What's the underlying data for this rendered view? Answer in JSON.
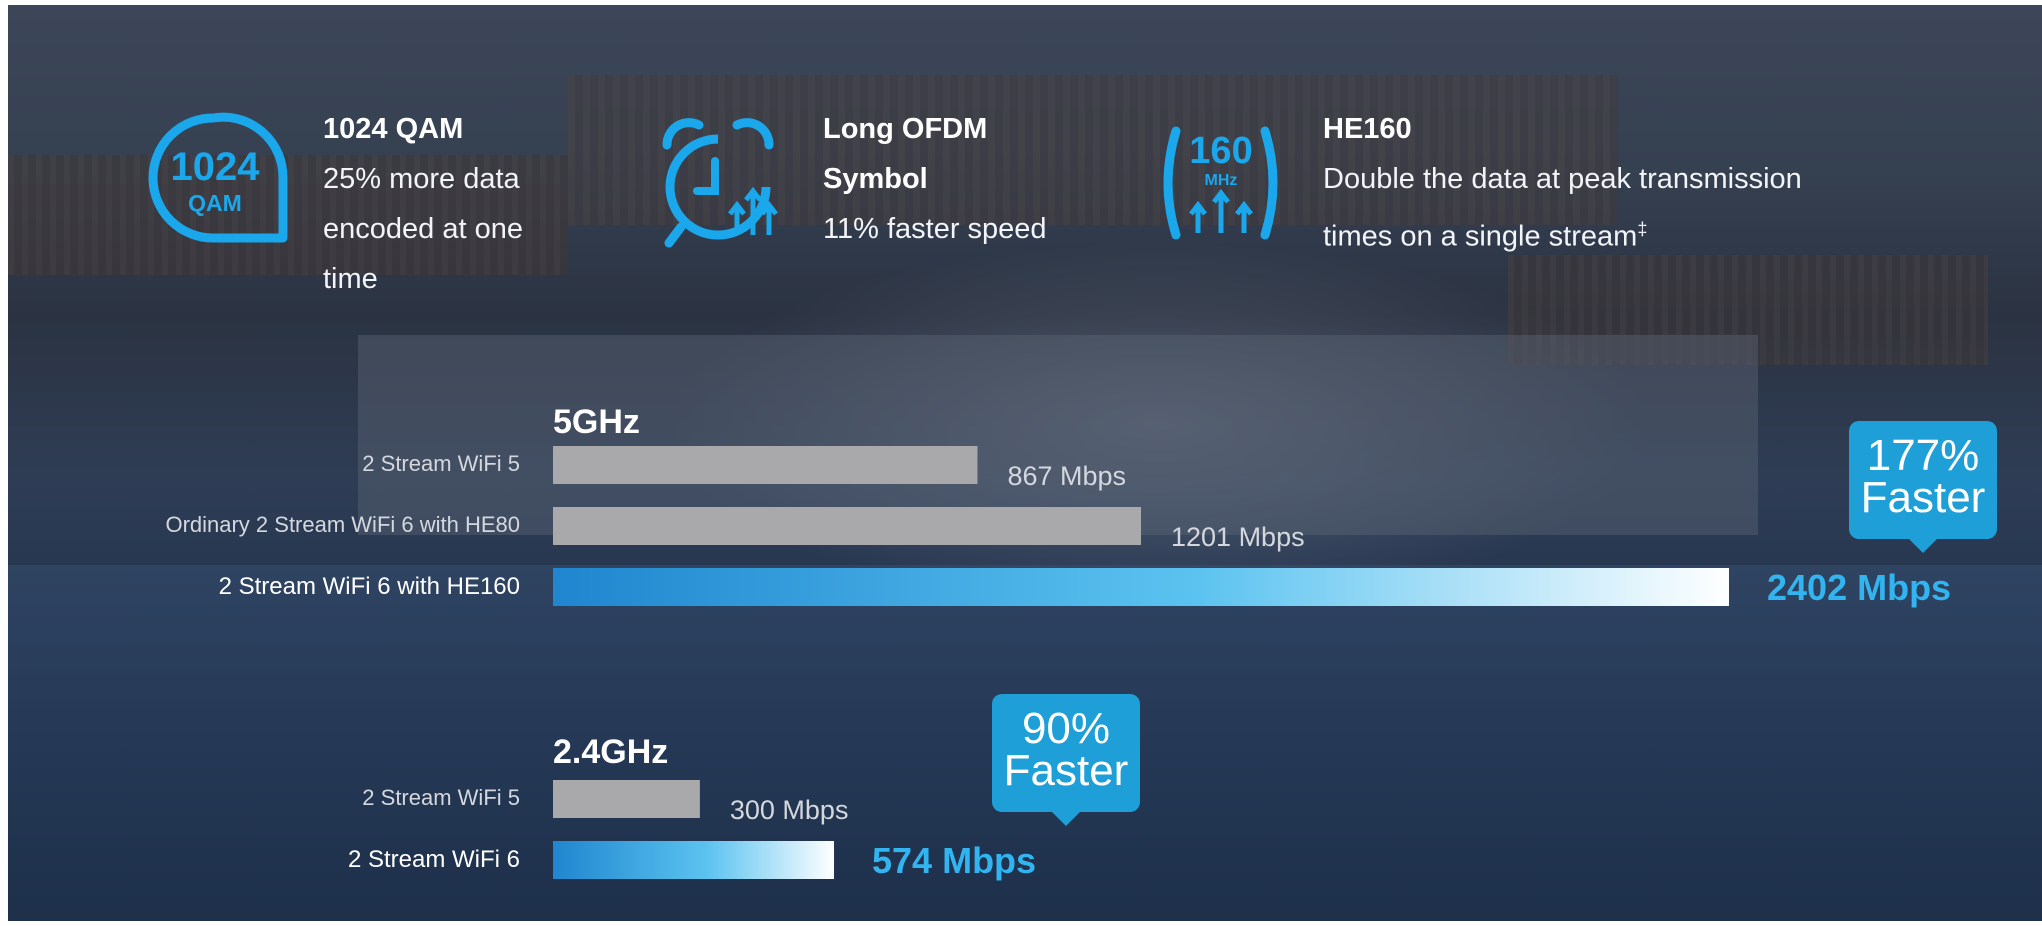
{
  "features": [
    {
      "icon": "qam-1024-icon",
      "icon_text": [
        "1024",
        "QAM"
      ],
      "title": "1024 QAM",
      "desc": [
        "25% more data",
        "encoded at one",
        "time"
      ]
    },
    {
      "icon": "alarm-clock-icon",
      "title_lines": [
        "Long OFDM",
        "Symbol"
      ],
      "desc": [
        "11% faster speed"
      ]
    },
    {
      "icon": "he160-icon",
      "icon_text": [
        "160",
        "MHz"
      ],
      "title": "HE160",
      "desc": [
        "Double the data at peak transmission",
        "times on a single stream"
      ],
      "footnote_mark": "‡"
    }
  ],
  "colors": {
    "accent": "#1e9fd8",
    "accent_text": "#32b4f0",
    "bar_gray": "#a9a9ab",
    "gradient_start": "#1f86cf",
    "gradient_end": "#ffffff"
  },
  "chart_data": [
    {
      "type": "bar",
      "orientation": "horizontal",
      "title": "5GHz",
      "categories": [
        "2 Stream WiFi 5",
        "Ordinary 2 Stream WiFi 6 with HE80",
        "2 Stream WiFi 6 with HE160"
      ],
      "values": [
        867,
        1201,
        2402
      ],
      "value_labels": [
        "867 Mbps",
        "1201 Mbps",
        "2402 Mbps"
      ],
      "highlight_index": 2,
      "callout": [
        "177%",
        "Faster"
      ],
      "xlim": [
        0,
        2402
      ]
    },
    {
      "type": "bar",
      "orientation": "horizontal",
      "title": "2.4GHz",
      "categories": [
        "2 Stream WiFi 5",
        "2 Stream WiFi 6"
      ],
      "values": [
        300,
        574
      ],
      "value_labels": [
        "300 Mbps",
        "574 Mbps"
      ],
      "highlight_index": 1,
      "callout": [
        "90%",
        "Faster"
      ],
      "xlim": [
        0,
        2402
      ]
    }
  ]
}
